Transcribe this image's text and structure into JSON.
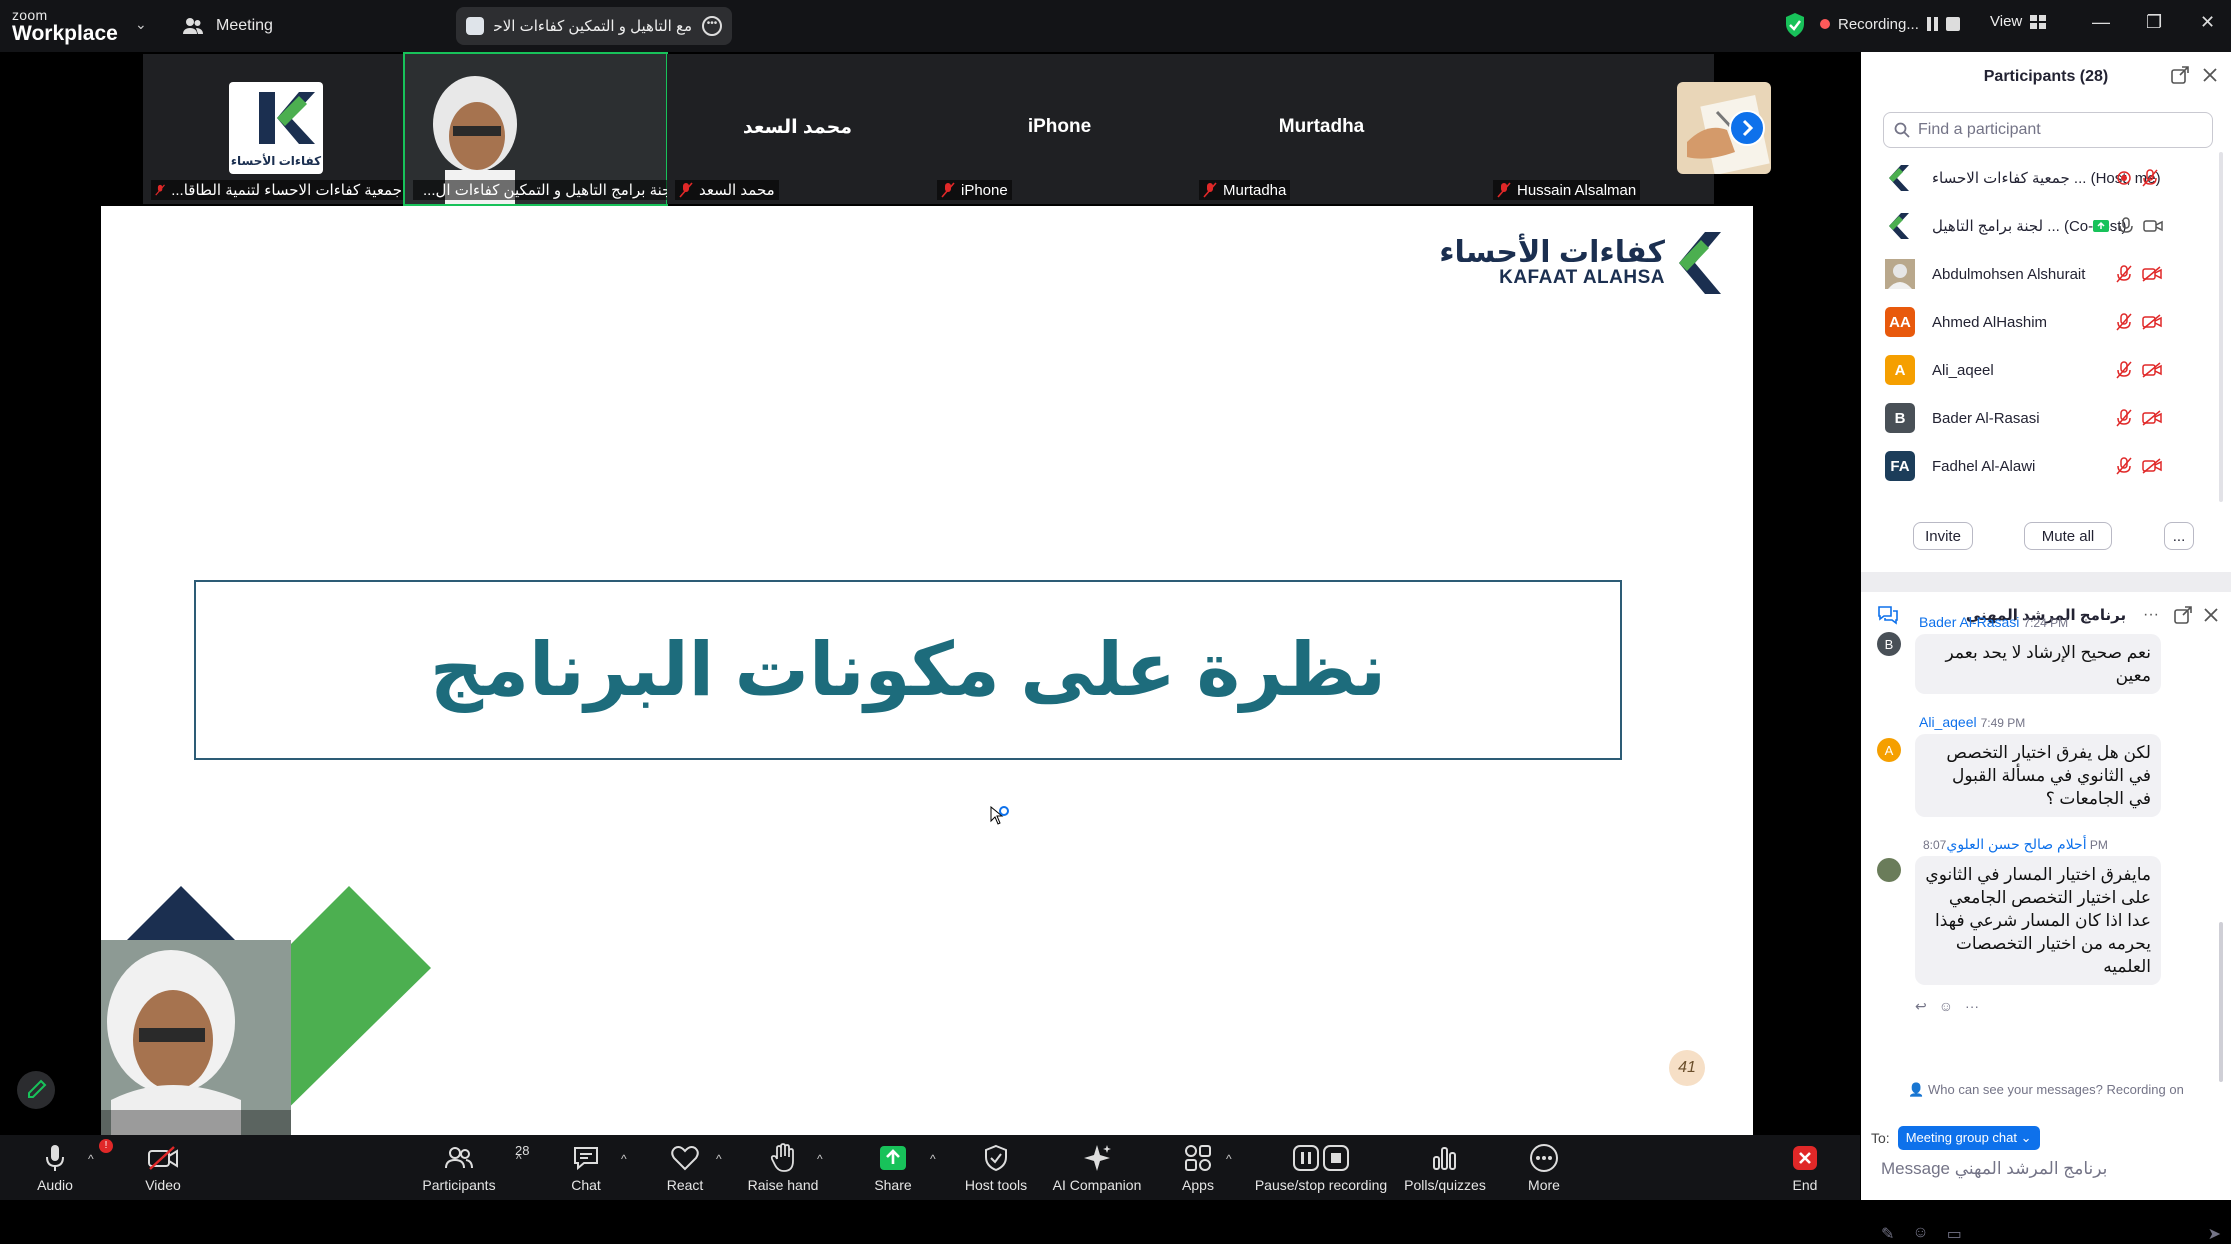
{
  "app": {
    "logo_top": "zoom",
    "logo_bottom": "Workplace",
    "meeting_label": "Meeting"
  },
  "tab": {
    "title": "مع التاهيل و التمكين كفاءات الاحساء"
  },
  "recording": {
    "label": "Recording...",
    "view_label": "View"
  },
  "strip": {
    "tiles": [
      {
        "caption": "جمعية كفاءات الاحساء لتنمية الطاقا...",
        "kind": "logo"
      },
      {
        "caption": "لجنة برامج التاهيل و التمكين كفاءات ال...",
        "kind": "video"
      },
      {
        "name": "محمد السعد",
        "caption": "محمد السعد"
      },
      {
        "name": "iPhone",
        "caption": "iPhone"
      },
      {
        "name": "Murtadha",
        "caption": "Murtadha"
      },
      {
        "caption": "Hussain Alsalman",
        "kind": "photo"
      }
    ],
    "logo_text": "كفاءات الأحساء"
  },
  "slide": {
    "logo_ar": "كفاءات الأحساء",
    "logo_en": "KAFAAT ALAHSA",
    "title": "نظرة على مكونات البرنامج",
    "page_number": "41"
  },
  "toolbar": {
    "audio": "Audio",
    "audio_badge": "!",
    "video": "Video",
    "participants": "Participants",
    "participants_count": "28",
    "chat": "Chat",
    "react": "React",
    "raise_hand": "Raise hand",
    "share": "Share",
    "host_tools": "Host tools",
    "ai_companion": "AI Companion",
    "apps": "Apps",
    "pause_stop": "Pause/stop recording",
    "polls": "Polls/quizzes",
    "more": "More",
    "end": "End"
  },
  "participants_panel": {
    "title": "Participants (28)",
    "search_placeholder": "Find a participant",
    "rows": [
      {
        "name": "جمعية كفاءات الاحساء ... (Host, me)",
        "avatar": "",
        "color": "#ffffff",
        "kind": "logo"
      },
      {
        "name": "لجنة برامج التاهيل ... (Co-host)",
        "avatar": "",
        "color": "#ffffff",
        "kind": "logo"
      },
      {
        "name": "Abdulmohsen Alshurait",
        "avatar": "",
        "color": "#8c7a62",
        "kind": "photo"
      },
      {
        "name": "Ahmed AlHashim",
        "avatar": "AA",
        "color": "#e8590c"
      },
      {
        "name": "Ali_aqeel",
        "avatar": "A",
        "color": "#f59f00"
      },
      {
        "name": "Bader Al-Rasasi",
        "avatar": "B",
        "color": "#495057"
      },
      {
        "name": "Fadhel Al-Alawi",
        "avatar": "FA",
        "color": "#1c3d5a"
      }
    ],
    "invite": "Invite",
    "mute_all": "Mute all",
    "more": "..."
  },
  "chat_panel": {
    "title": "برنامج المرشد المهني",
    "messages": [
      {
        "sender": "Bader Al-Rasasi",
        "time": "7:24 PM",
        "avatar": "B",
        "color": "#495057",
        "text": "نعم صحيح الإرشاد لا يحد بعمر معين"
      },
      {
        "sender": "Ali_aqeel",
        "time": "7:49 PM",
        "avatar": "A",
        "color": "#f59f00",
        "text": "لكن هل يفرق اختيار التخصص في الثانوي في مسألة القبول في الجامعات ؟"
      },
      {
        "sender": "أحلام صالح حسن العلوي",
        "time": "8:07 PM",
        "avatar": "",
        "color": "#6a7c5a",
        "text": "مايفرق اختيار المسار في الثانوي على اختيار التخصص الجامعي عدا اذا كان المسار شرعي فهذا يحرمه من اختيار التخصصات العلميه"
      }
    ],
    "privacy_note": "Who can see your messages? Recording on",
    "to_label": "To:",
    "recipient": "Meeting group chat",
    "input_placeholder": "Message برنامج المرشد المهني"
  },
  "colors": {
    "accent": "#0e71eb",
    "active_border": "#18c25a",
    "slide_title": "#1d6c7c",
    "end": "#e02828"
  }
}
